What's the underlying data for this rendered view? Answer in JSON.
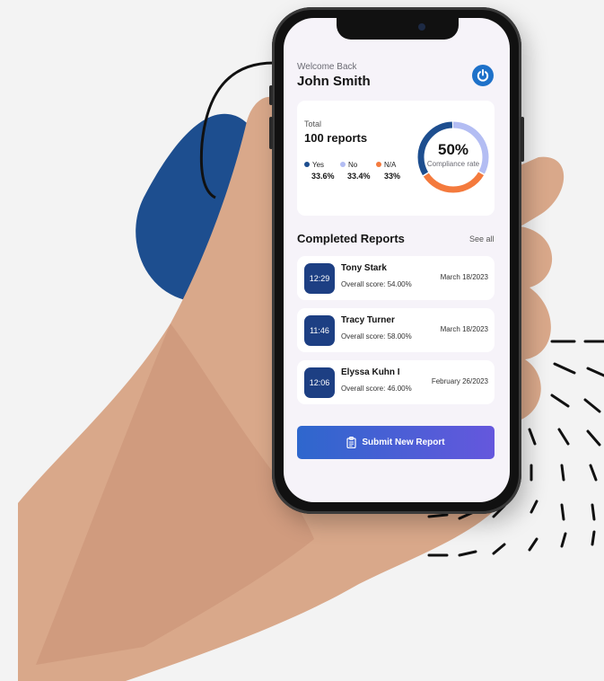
{
  "header": {
    "greeting": "Welcome Back",
    "user_name": "John Smith",
    "power_icon": "power-icon"
  },
  "summary": {
    "total_label": "Total",
    "total_value": "100 reports",
    "legend": [
      {
        "label": "Yes",
        "value": "33.6%",
        "color": "#1d4e8f"
      },
      {
        "label": "No",
        "value": "33.4%",
        "color": "#b3bdf3"
      },
      {
        "label": "N/A",
        "value": "33%",
        "color": "#f47a3d"
      }
    ],
    "compliance_percent": "50%",
    "compliance_caption": "Compliance rate",
    "donut_segments": [
      {
        "label": "Yes",
        "fraction": 0.336,
        "color": "#1d4e8f"
      },
      {
        "label": "No",
        "fraction": 0.334,
        "color": "#b3bdf3"
      },
      {
        "label": "N/A",
        "fraction": 0.33,
        "color": "#f47a3d"
      }
    ]
  },
  "completed": {
    "title": "Completed Reports",
    "see_all": "See all",
    "reports": [
      {
        "time": "12:29",
        "name": "Tony Stark",
        "score": "Overall score: 54.00%",
        "date": "March 18/2023"
      },
      {
        "time": "11:46",
        "name": "Tracy Turner",
        "score": "Overall score: 58.00%",
        "date": "March 18/2023"
      },
      {
        "time": "12:06",
        "name": "Elyssa Kuhn I",
        "score": "Overall score: 46.00%",
        "date": "February 26/2023"
      }
    ]
  },
  "actions": {
    "submit_label": "Submit New Report",
    "submit_icon": "clipboard-icon"
  },
  "colors": {
    "accent": "#1e71c9",
    "time_badge": "#1d3f83",
    "button_gradient_start": "#2e67cd",
    "button_gradient_end": "#6557dd",
    "decor_blob": "#1d4e8f"
  }
}
